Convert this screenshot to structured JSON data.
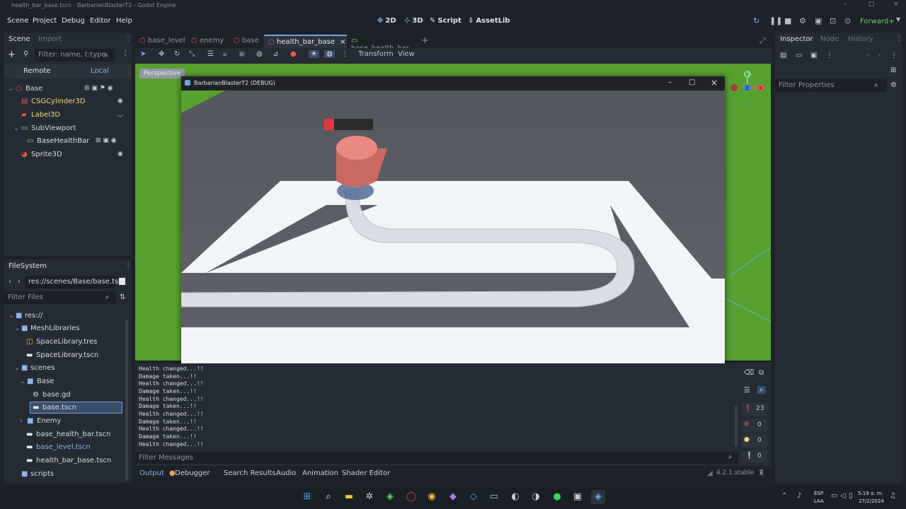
{
  "window": {
    "title": "health_bar_base.tscn - BarbarianBlasterT2 - Godot Engine",
    "minimize": "–",
    "maximize": "□",
    "close": "×"
  },
  "menu": [
    "Scene",
    "Project",
    "Debug",
    "Editor",
    "Help"
  ],
  "modes": {
    "m2d": "2D",
    "m3d": "3D",
    "script": "Script",
    "assetlib": "AssetLib"
  },
  "renderer": "Forward+",
  "scene_dock": {
    "tab_scene": "Scene",
    "tab_import": "Import",
    "filter_placeholder": "Filter: name, t:type,",
    "remote": "Remote",
    "local": "Local",
    "nodes": [
      {
        "label": "Base",
        "color": "#e8eaee"
      },
      {
        "label": "CSGCylinder3D",
        "color": "#f1d77a"
      },
      {
        "label": "Label3D",
        "color": "#f1d77a"
      },
      {
        "label": "SubViewport",
        "color": "#e8eaee"
      },
      {
        "label": "BaseHealthBar",
        "color": "#e8eaee"
      },
      {
        "label": "Sprite3D",
        "color": "#e8eaee"
      }
    ]
  },
  "filesystem": {
    "title": "FileSystem",
    "path": "res://scenes/Base/base.tsc",
    "filter_placeholder": "Filter Files",
    "items": [
      {
        "label": "res://",
        "indent": 0
      },
      {
        "label": "MeshLibraries",
        "indent": 1
      },
      {
        "label": "SpaceLibrary.tres",
        "indent": 2
      },
      {
        "label": "SpaceLibrary.tscn",
        "indent": 2
      },
      {
        "label": "scenes",
        "indent": 1
      },
      {
        "label": "Base",
        "indent": 2
      },
      {
        "label": "base.gd",
        "indent": 3
      },
      {
        "label": "base.tscn",
        "indent": 3
      },
      {
        "label": "Enemy",
        "indent": 2
      },
      {
        "label": "base_health_bar.tscn",
        "indent": 2
      },
      {
        "label": "base_level.tscn",
        "indent": 2
      },
      {
        "label": "health_bar_base.tscn",
        "indent": 2
      },
      {
        "label": "scripts",
        "indent": 1
      }
    ]
  },
  "editor_tabs": [
    "base_level",
    "enemy",
    "base",
    "health_bar_base",
    "base_health_bar"
  ],
  "toolbar": {
    "transform": "Transform",
    "view": "View",
    "perspective": "Perspective"
  },
  "debug_window": {
    "title": "BarbarianBlasterT2 (DEBUG)",
    "health_fraction": 0.2
  },
  "inspector": {
    "tab_inspector": "Inspector",
    "tab_node": "Node",
    "tab_history": "History",
    "filter_placeholder": "Filter Properties"
  },
  "console": {
    "lines": [
      "Health changed...!!",
      "Damage taken...!!",
      "Health changed...!!",
      "Damage taken...!!",
      "Health changed...!!",
      "Damage taken...!!",
      "Health changed...!!",
      "Damage taken...!!",
      "Health changed...!!",
      "Damage taken...!!",
      "Health changed...!!"
    ],
    "filter_placeholder": "Filter Messages",
    "counts": {
      "messages": "23",
      "errors": "0",
      "warnings": "0",
      "info": "0"
    }
  },
  "bottom_tabs": [
    "Output",
    "Debugger",
    "Search Results",
    "Audio",
    "Animation",
    "Shader Editor"
  ],
  "version": "4.2.1.stable",
  "taskbar": {
    "lang": "ESP",
    "region": "LAA",
    "time": "5:19 a. m.",
    "date": "27/2/2024"
  },
  "colors": {
    "accent": "#6fa3e0",
    "health_fill": "#e8363e",
    "health_bg": "#2b2b2d",
    "grass": "#56a02f",
    "ground": "#f1f4f7",
    "path": "#d9dee5",
    "trench": "#5a5e66",
    "cylinder": "#e57e74"
  }
}
